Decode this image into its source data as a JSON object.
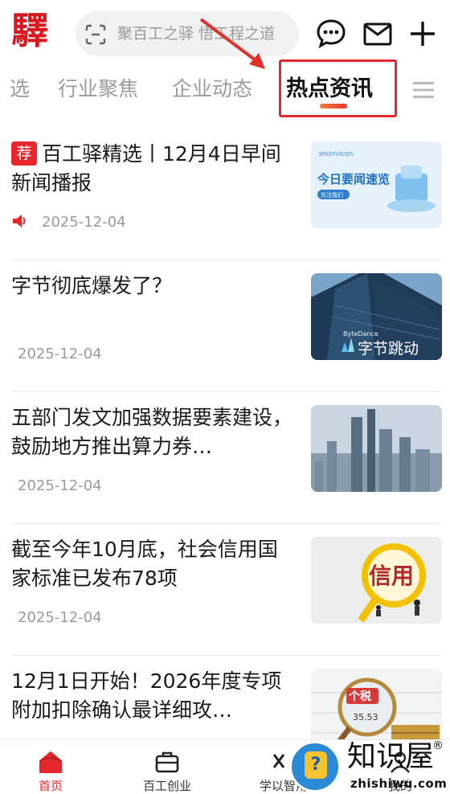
{
  "header": {
    "logo": "驛",
    "search_placeholder": "聚百工之驿 悟工程之道"
  },
  "tabs": [
    {
      "label": "选"
    },
    {
      "label": "行业聚焦"
    },
    {
      "label": "企业动态"
    },
    {
      "label": "热点资讯",
      "active": true
    }
  ],
  "feed": [
    {
      "badge": "荐",
      "title": "百工驿精选丨12月4日早间新闻播报",
      "date": "2025-12-04",
      "thumb_text": "今日要闻速览",
      "thumb_sub": "关注我们",
      "thumb_brand": "BRIEFVIEWS"
    },
    {
      "title": "字节彻底爆发了？",
      "date": "2025-12-04",
      "thumb_text": "字节跳动",
      "thumb_brand": "ByteDance"
    },
    {
      "title": "五部门发文加强数据要素建设，鼓励地方推出算力券…",
      "date": "2025-12-04"
    },
    {
      "title": "截至今年10月底，社会信用国家标准已发布78项",
      "date": "2025-12-04",
      "thumb_text": "信用"
    },
    {
      "title": "12月1日开始！2026年度专项附加扣除确认最详细攻…",
      "date": "",
      "thumb_text": "个税",
      "thumb_num": "35.53"
    }
  ],
  "bottom_nav": [
    {
      "label": "首页",
      "active": true
    },
    {
      "label": "百工创业"
    },
    {
      "label": "学以智用"
    },
    {
      "label": "我的"
    }
  ],
  "watermark": {
    "brand": "知识屋",
    "reg": "®",
    "domain": "zhishiwu.com"
  },
  "colors": {
    "accent": "#e5282c",
    "tab_highlight": "#e02a2a"
  }
}
